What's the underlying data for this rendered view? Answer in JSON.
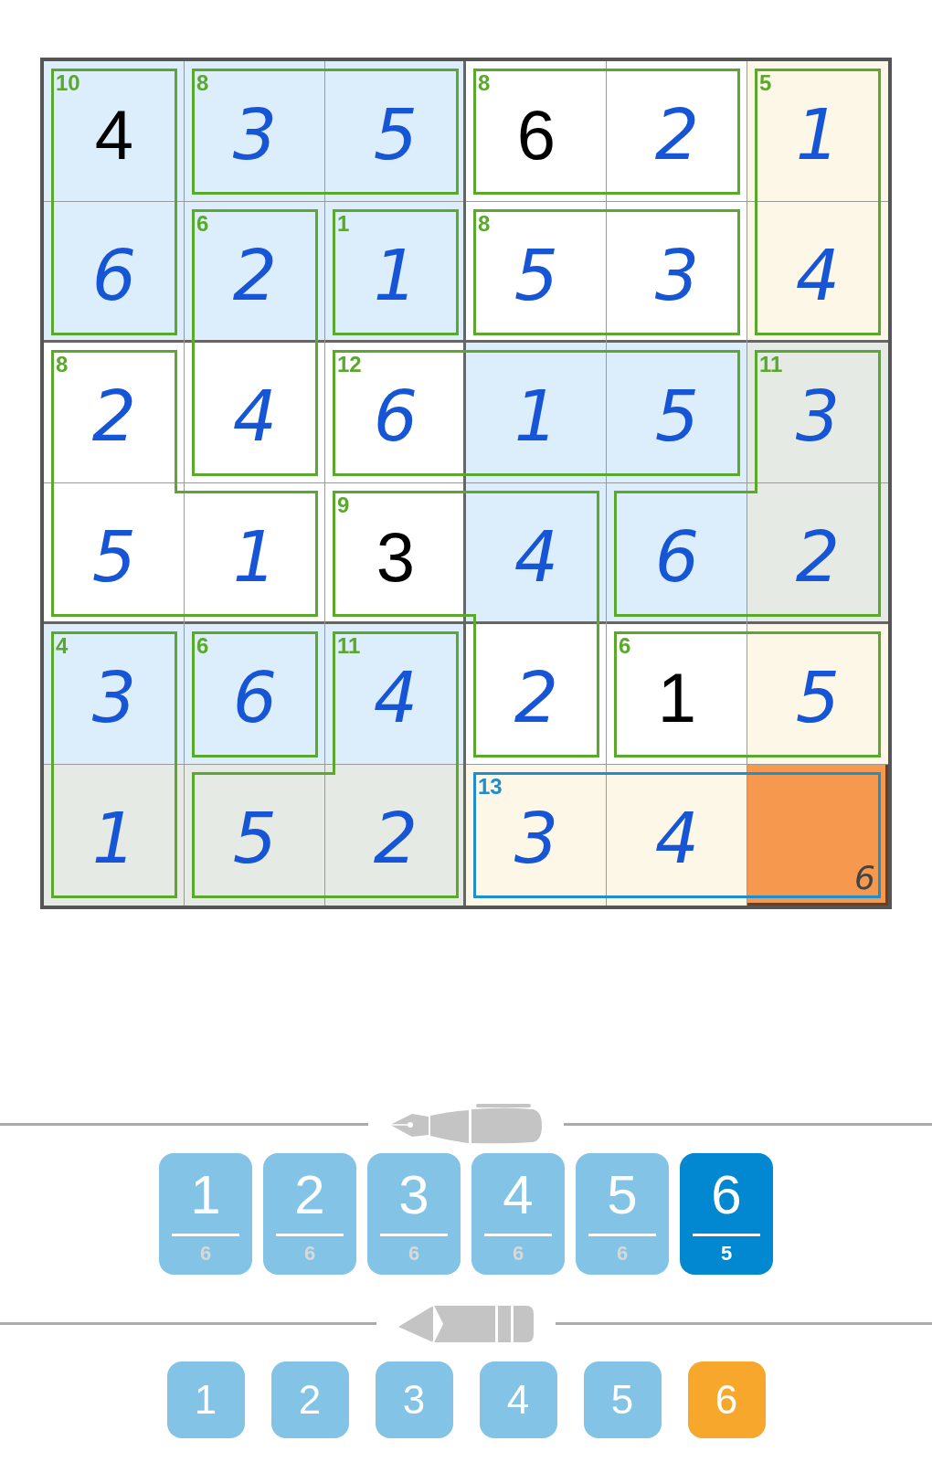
{
  "grid": [
    [
      {
        "value": "4",
        "kind": "given",
        "color": "#dcedfb",
        "selected": false,
        "cage_border": {
          "top": true,
          "right": true,
          "bottom": false,
          "left": true
        },
        "cage_selected": false,
        "cage_sum": "10"
      },
      {
        "value": "3",
        "kind": "entered",
        "color": "#dcedfb",
        "selected": false,
        "cage_border": {
          "top": true,
          "right": false,
          "bottom": true,
          "left": true
        },
        "cage_selected": false,
        "cage_sum": "8"
      },
      {
        "value": "5",
        "kind": "entered",
        "color": "#dcedfb",
        "selected": false,
        "cage_border": {
          "top": true,
          "right": true,
          "bottom": true,
          "left": false
        }
      },
      {
        "value": "6",
        "kind": "given",
        "color": "#ffffff",
        "selected": false,
        "cage_border": {
          "top": true,
          "right": false,
          "bottom": true,
          "left": true
        },
        "cage_selected": false,
        "cage_sum": "8"
      },
      {
        "value": "2",
        "kind": "entered",
        "color": "#ffffff",
        "selected": false,
        "cage_border": {
          "top": true,
          "right": true,
          "bottom": true,
          "left": false
        }
      },
      {
        "value": "1",
        "kind": "entered",
        "color": "#fdf7e7",
        "selected": false,
        "cage_border": {
          "top": true,
          "right": true,
          "bottom": false,
          "left": true
        },
        "cage_selected": false,
        "cage_sum": "5"
      }
    ],
    [
      {
        "value": "6",
        "kind": "entered",
        "color": "#dcedfb",
        "selected": false,
        "cage_border": {
          "top": false,
          "right": true,
          "bottom": true,
          "left": true
        }
      },
      {
        "value": "2",
        "kind": "entered",
        "color": "#dcedfb",
        "selected": false,
        "cage_border": {
          "top": true,
          "right": true,
          "bottom": false,
          "left": true
        },
        "cage_selected": false,
        "cage_sum": "6"
      },
      {
        "value": "1",
        "kind": "entered",
        "color": "#dcedfb",
        "selected": false,
        "cage_border": {
          "top": true,
          "right": true,
          "bottom": true,
          "left": true
        },
        "cage_selected": false,
        "cage_sum": "1"
      },
      {
        "value": "5",
        "kind": "entered",
        "color": "#ffffff",
        "selected": false,
        "cage_border": {
          "top": true,
          "right": false,
          "bottom": true,
          "left": true
        },
        "cage_selected": false,
        "cage_sum": "8"
      },
      {
        "value": "3",
        "kind": "entered",
        "color": "#ffffff",
        "selected": false,
        "cage_border": {
          "top": true,
          "right": true,
          "bottom": true,
          "left": false
        }
      },
      {
        "value": "4",
        "kind": "entered",
        "color": "#fdf7e7",
        "selected": false,
        "cage_border": {
          "top": false,
          "right": true,
          "bottom": true,
          "left": true
        }
      }
    ],
    [
      {
        "value": "2",
        "kind": "entered",
        "color": "#ffffff",
        "selected": false,
        "cage_border": {
          "top": true,
          "right": true,
          "bottom": false,
          "left": true
        },
        "cage_selected": false,
        "cage_sum": "8"
      },
      {
        "value": "4",
        "kind": "entered",
        "color": "#ffffff",
        "selected": false,
        "cage_border": {
          "top": false,
          "right": true,
          "bottom": true,
          "left": true
        }
      },
      {
        "value": "6",
        "kind": "entered",
        "color": "#ffffff",
        "selected": false,
        "cage_border": {
          "top": true,
          "right": false,
          "bottom": true,
          "left": true
        },
        "cage_selected": false,
        "cage_sum": "12"
      },
      {
        "value": "1",
        "kind": "entered",
        "color": "#dcedfb",
        "selected": false,
        "cage_border": {
          "top": true,
          "right": false,
          "bottom": true,
          "left": false
        }
      },
      {
        "value": "5",
        "kind": "entered",
        "color": "#dcedfb",
        "selected": false,
        "cage_border": {
          "top": true,
          "right": true,
          "bottom": true,
          "left": false
        }
      },
      {
        "value": "3",
        "kind": "entered",
        "color": "#e5ebe4",
        "selected": false,
        "cage_border": {
          "top": true,
          "right": true,
          "bottom": false,
          "left": true
        },
        "cage_selected": false,
        "cage_sum": "11"
      }
    ],
    [
      {
        "value": "5",
        "kind": "entered",
        "color": "#ffffff",
        "selected": false,
        "cage_border": {
          "top": false,
          "right": false,
          "bottom": true,
          "left": true
        }
      },
      {
        "value": "1",
        "kind": "entered",
        "color": "#ffffff",
        "selected": false,
        "cage_border": {
          "top": true,
          "right": true,
          "bottom": true,
          "left": false
        }
      },
      {
        "value": "3",
        "kind": "given",
        "color": "#ffffff",
        "selected": false,
        "cage_border": {
          "top": true,
          "right": false,
          "bottom": true,
          "left": true
        },
        "cage_selected": false,
        "cage_sum": "9"
      },
      {
        "value": "4",
        "kind": "entered",
        "color": "#dcedfb",
        "selected": false,
        "cage_border": {
          "top": true,
          "right": true,
          "bottom": false,
          "left": false
        }
      },
      {
        "value": "6",
        "kind": "entered",
        "color": "#dcedfb",
        "selected": false,
        "cage_border": {
          "top": true,
          "right": false,
          "bottom": true,
          "left": true
        }
      },
      {
        "value": "2",
        "kind": "entered",
        "color": "#e5ebe4",
        "selected": false,
        "cage_border": {
          "top": false,
          "right": true,
          "bottom": true,
          "left": false
        }
      }
    ],
    [
      {
        "value": "3",
        "kind": "entered",
        "color": "#dcedfb",
        "selected": false,
        "cage_border": {
          "top": true,
          "right": true,
          "bottom": false,
          "left": true
        },
        "cage_selected": false,
        "cage_sum": "4"
      },
      {
        "value": "6",
        "kind": "entered",
        "color": "#dcedfb",
        "selected": false,
        "cage_border": {
          "top": true,
          "right": true,
          "bottom": true,
          "left": true
        },
        "cage_selected": false,
        "cage_sum": "6"
      },
      {
        "value": "4",
        "kind": "entered",
        "color": "#dcedfb",
        "selected": false,
        "cage_border": {
          "top": true,
          "right": true,
          "bottom": false,
          "left": true
        },
        "cage_selected": false,
        "cage_sum": "11"
      },
      {
        "value": "2",
        "kind": "entered",
        "color": "#ffffff",
        "selected": false,
        "cage_border": {
          "top": false,
          "right": true,
          "bottom": true,
          "left": true
        }
      },
      {
        "value": "1",
        "kind": "given",
        "color": "#ffffff",
        "selected": false,
        "cage_border": {
          "top": true,
          "right": false,
          "bottom": true,
          "left": true
        },
        "cage_selected": false,
        "cage_sum": "6"
      },
      {
        "value": "5",
        "kind": "entered",
        "color": "#fdf7e7",
        "selected": false,
        "cage_border": {
          "top": true,
          "right": true,
          "bottom": true,
          "left": false
        }
      }
    ],
    [
      {
        "value": "1",
        "kind": "entered",
        "color": "#e5ebe4",
        "selected": false,
        "cage_border": {
          "top": false,
          "right": true,
          "bottom": true,
          "left": true
        }
      },
      {
        "value": "5",
        "kind": "entered",
        "color": "#e5ebe4",
        "selected": false,
        "cage_border": {
          "top": true,
          "right": false,
          "bottom": true,
          "left": true
        }
      },
      {
        "value": "2",
        "kind": "entered",
        "color": "#e5ebe4",
        "selected": false,
        "cage_border": {
          "top": false,
          "right": true,
          "bottom": true,
          "left": false
        }
      },
      {
        "value": "3",
        "kind": "entered",
        "color": "#fdf7e7",
        "selected": false,
        "cage_border": {
          "top": true,
          "right": false,
          "bottom": true,
          "left": true
        },
        "cage_selected": true,
        "cage_sum": "13"
      },
      {
        "value": "4",
        "kind": "entered",
        "color": "#fdf7e7",
        "selected": false,
        "cage_border": {
          "top": true,
          "right": false,
          "bottom": true,
          "left": false
        }
      },
      {
        "notes": "6",
        "color": "#f7984f",
        "selected": true,
        "cage_border": {
          "top": true,
          "right": true,
          "bottom": true,
          "left": false
        }
      }
    ]
  ],
  "pen_digits": [
    {
      "digit": "1",
      "count": "6",
      "selected": false
    },
    {
      "digit": "2",
      "count": "6",
      "selected": false
    },
    {
      "digit": "3",
      "count": "6",
      "selected": false
    },
    {
      "digit": "4",
      "count": "6",
      "selected": false
    },
    {
      "digit": "5",
      "count": "6",
      "selected": false
    },
    {
      "digit": "6",
      "count": "5",
      "selected": true
    }
  ],
  "pencil_digits": [
    {
      "digit": "1",
      "selected": false
    },
    {
      "digit": "2",
      "selected": false
    },
    {
      "digit": "3",
      "selected": false
    },
    {
      "digit": "4",
      "selected": false
    },
    {
      "digit": "5",
      "selected": false
    },
    {
      "digit": "6",
      "selected": true
    }
  ]
}
